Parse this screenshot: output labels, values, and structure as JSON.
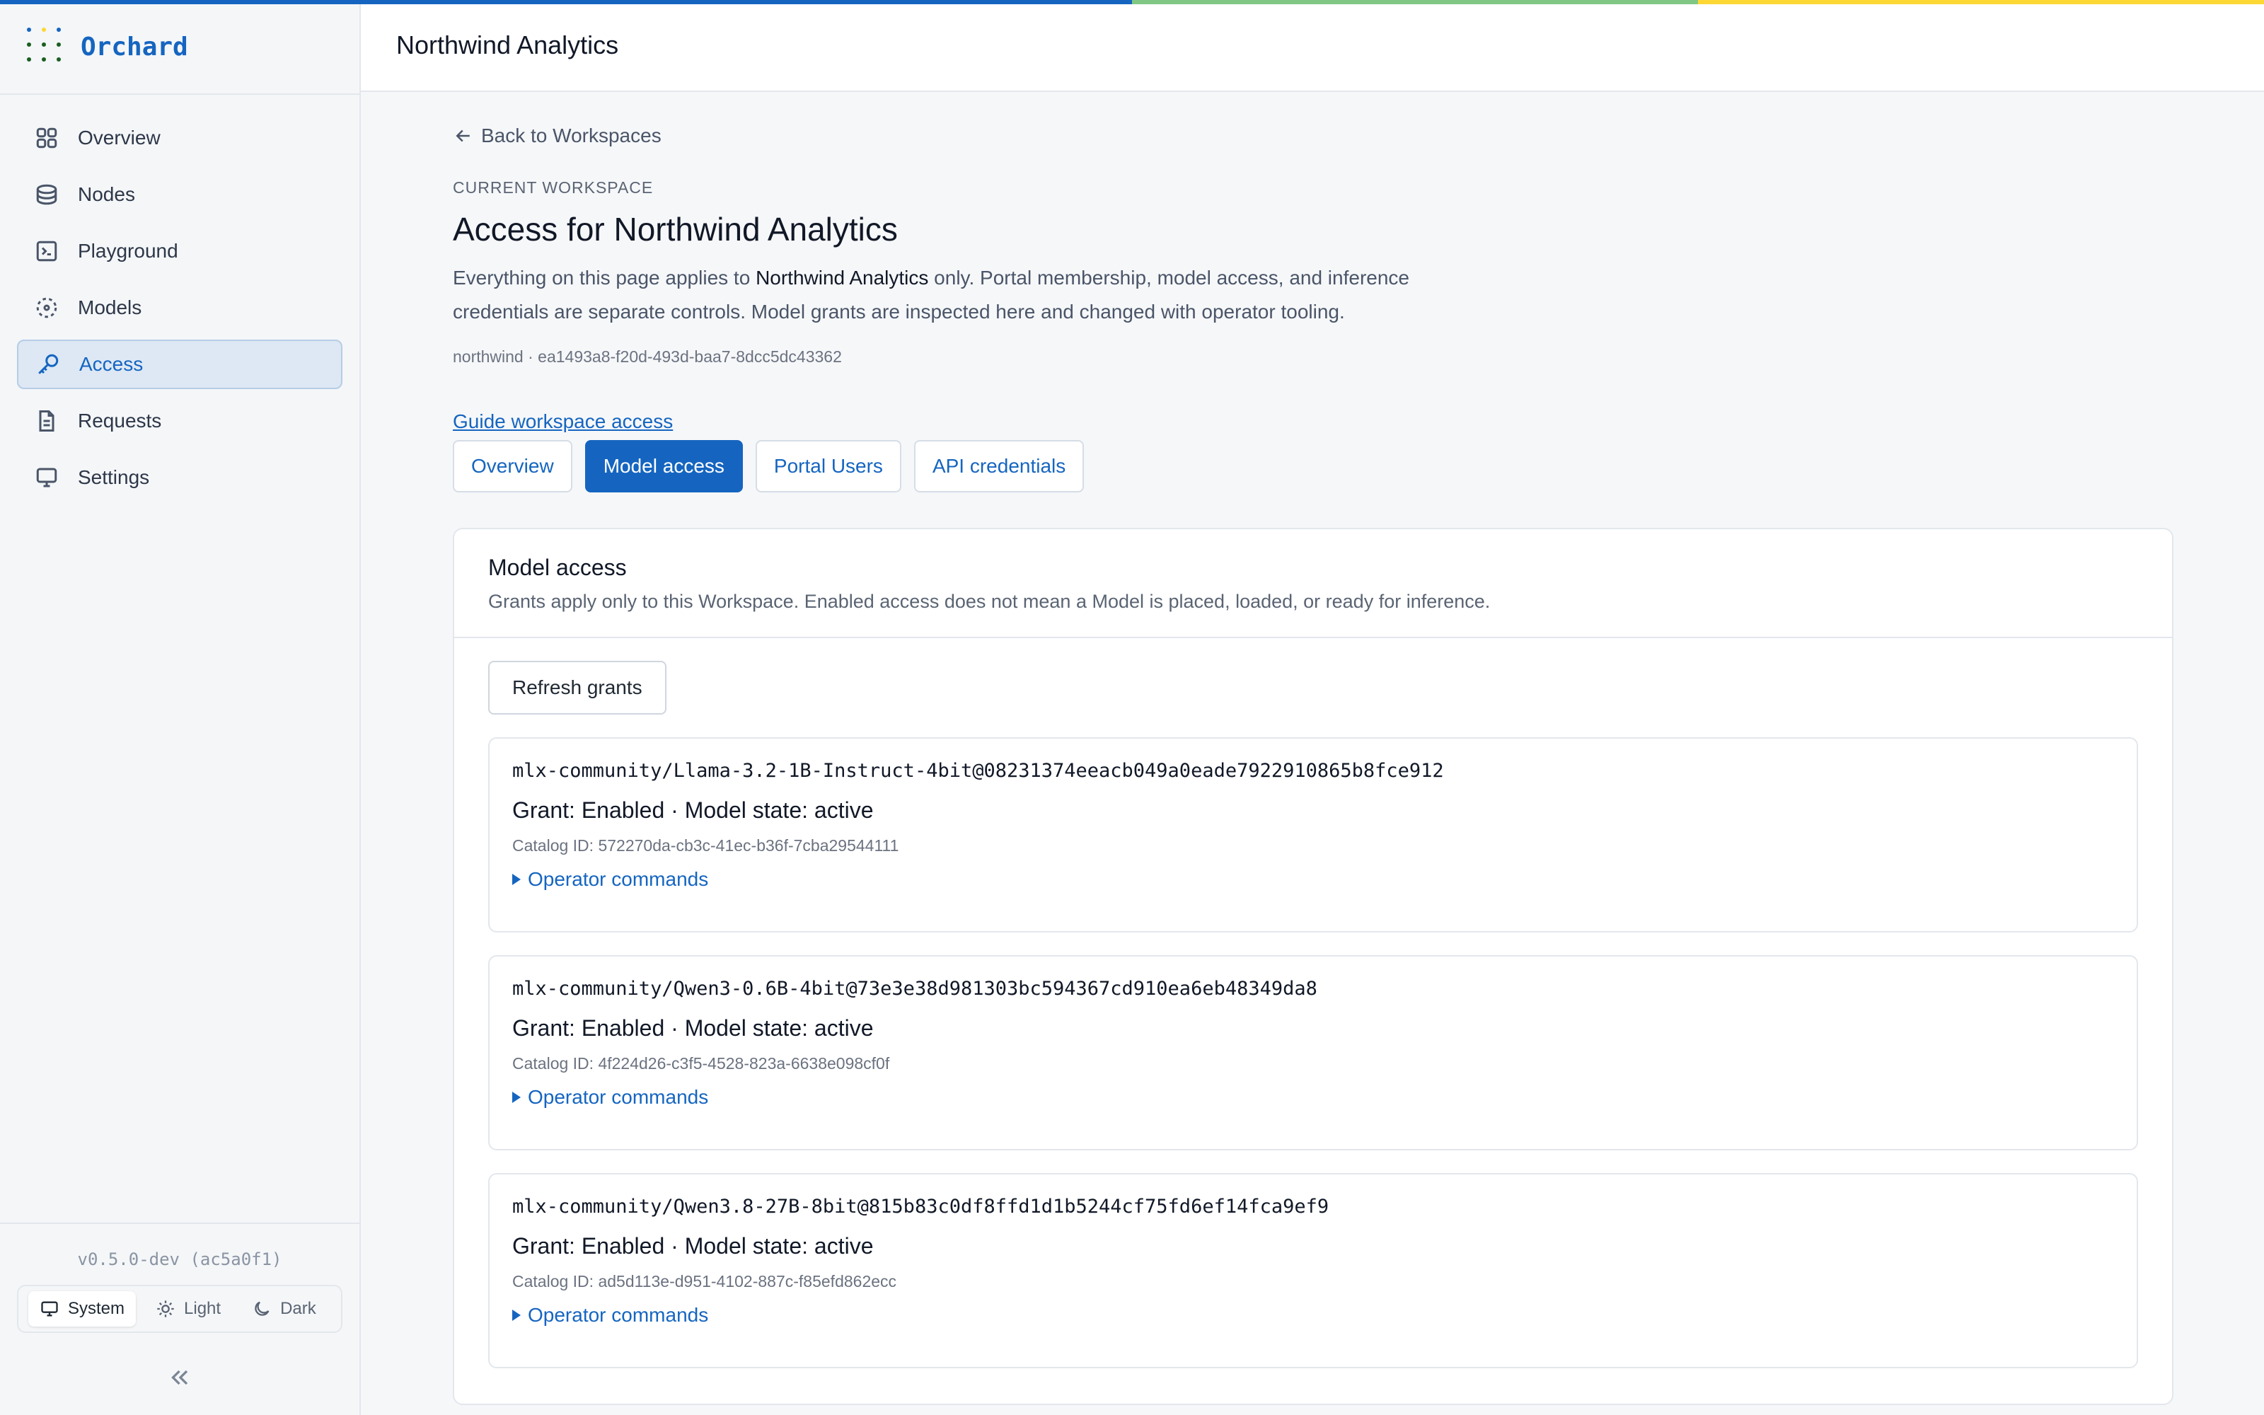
{
  "colors": {
    "accent": "#1565c0",
    "topbar": [
      "#1565c0",
      "#1b5e20",
      "#81c784",
      "#fdd835"
    ]
  },
  "app": {
    "name": "Orchard"
  },
  "sidebar": {
    "items": [
      {
        "label": "Overview",
        "icon": "grid-icon"
      },
      {
        "label": "Nodes",
        "icon": "server-icon"
      },
      {
        "label": "Playground",
        "icon": "terminal-icon"
      },
      {
        "label": "Models",
        "icon": "models-icon"
      },
      {
        "label": "Access",
        "icon": "key-icon",
        "active": true
      },
      {
        "label": "Requests",
        "icon": "document-icon"
      },
      {
        "label": "Settings",
        "icon": "monitor-icon"
      }
    ],
    "version": "v0.5.0-dev (ac5a0f1)",
    "theme": {
      "options": [
        "System",
        "Light",
        "Dark"
      ],
      "selected": "System"
    }
  },
  "header": {
    "title": "Northwind Analytics"
  },
  "main": {
    "back_label": "Back to Workspaces",
    "eyebrow": "CURRENT WORKSPACE",
    "title": "Access for Northwind Analytics",
    "desc_prefix": "Everything on this page applies to ",
    "desc_bold": "Northwind Analytics",
    "desc_suffix": " only. Portal membership, model access, and inference credentials are separate controls. Model grants are inspected here and changed with operator tooling.",
    "ids": "northwind · ea1493a8-f20d-493d-baa7-8dcc5dc43362",
    "guide_link": "Guide workspace access",
    "tabs": [
      {
        "label": "Overview"
      },
      {
        "label": "Model access",
        "active": true
      },
      {
        "label": "Portal Users"
      },
      {
        "label": "API credentials"
      }
    ]
  },
  "panel": {
    "title": "Model access",
    "subtitle": "Grants apply only to this Workspace. Enabled access does not mean a Model is placed, loaded, or ready for inference.",
    "refresh_label": "Refresh grants",
    "grants": [
      {
        "model": "mlx-community/Llama-3.2-1B-Instruct-4bit@08231374eeacb049a0eade7922910865b8fce912",
        "state": "Grant: Enabled · Model state: active",
        "catalog": "Catalog ID: 572270da-cb3c-41ec-b36f-7cba29544111",
        "ops": "Operator commands"
      },
      {
        "model": "mlx-community/Qwen3-0.6B-4bit@73e3e38d981303bc594367cd910ea6eb48349da8",
        "state": "Grant: Enabled · Model state: active",
        "catalog": "Catalog ID: 4f224d26-c3f5-4528-823a-6638e098cf0f",
        "ops": "Operator commands"
      },
      {
        "model": "mlx-community/Qwen3.8-27B-8bit@815b83c0df8ffd1d1b5244cf75fd6ef14fca9ef9",
        "state": "Grant: Enabled · Model state: active",
        "catalog": "Catalog ID: ad5d113e-d951-4102-887c-f85efd862ecc",
        "ops": "Operator commands"
      }
    ]
  }
}
